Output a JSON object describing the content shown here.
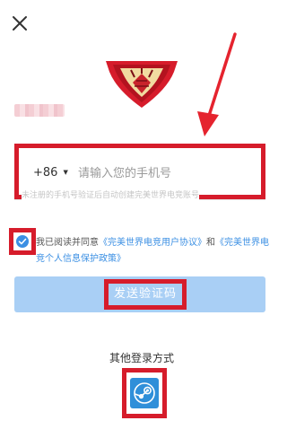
{
  "header": {
    "close_icon": "close-icon"
  },
  "brand": {
    "logo_icon": "perfect-world-esports-logo",
    "accent": "#d61c2b"
  },
  "phone": {
    "country_code": "+86",
    "placeholder": "请输入您的手机号",
    "value": "",
    "note": "未注册的手机号验证后自动创建完美世界电竞账号"
  },
  "agreement": {
    "checked": true,
    "prefix": "我已阅读并同意",
    "link_user": "《完美世界电竞用户协议》",
    "conjunction": "和",
    "link_privacy": "《完美世界电竞个人信息保护政策》"
  },
  "send_button": {
    "label": "发送验证码",
    "color": "#a9cff5"
  },
  "other_login": {
    "title": "其他登录方式",
    "steam_icon": "steam-icon",
    "steam_color": "#2f8fd9"
  },
  "annotations": {
    "highlight_color": "#d61c2b"
  }
}
